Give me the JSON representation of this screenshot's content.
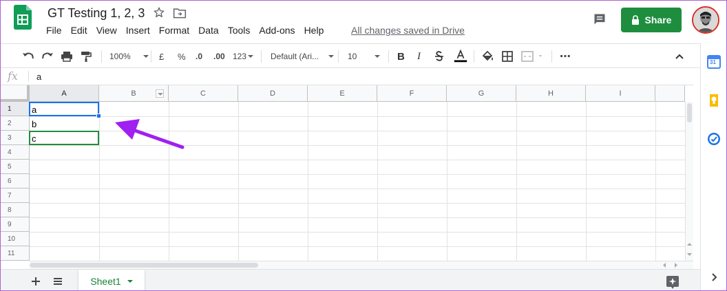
{
  "app": {
    "title": "GT Testing 1, 2, 3",
    "saved_status": "All changes saved in Drive",
    "share_label": "Share"
  },
  "menu": [
    "File",
    "Edit",
    "View",
    "Insert",
    "Format",
    "Data",
    "Tools",
    "Add-ons",
    "Help"
  ],
  "toolbar": {
    "zoom": "100%",
    "currency": "£",
    "percent": "%",
    "decrease_decimal": ".0",
    "increase_decimal": ".00",
    "number_format": "123",
    "font": "Default (Ari...",
    "font_size": "10",
    "bold": "B",
    "italic": "I",
    "more": "⋯"
  },
  "formula_bar": {
    "fx_label": "fx",
    "value": "a"
  },
  "grid": {
    "columns": [
      "A",
      "B",
      "C",
      "D",
      "E",
      "F",
      "G",
      "H",
      "I"
    ],
    "rows": [
      "1",
      "2",
      "3",
      "4",
      "5",
      "6",
      "7",
      "8",
      "9",
      "10",
      "11"
    ],
    "cells": {
      "A1": "a",
      "A2": "b",
      "A3": "c"
    }
  },
  "sheets": {
    "active": "Sheet1"
  },
  "side_panel": {
    "calendar_label": "31"
  },
  "colors": {
    "share_green": "#1e8e3e",
    "selection_blue": "#1a73e8",
    "annotation_purple": "#a020f0"
  }
}
